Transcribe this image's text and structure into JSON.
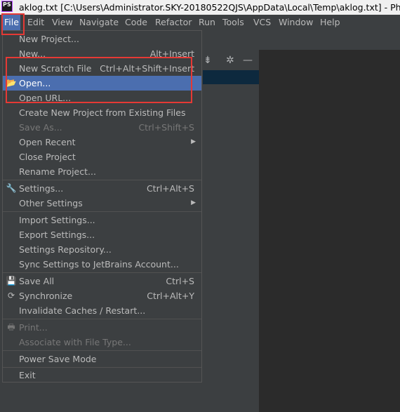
{
  "window": {
    "title": "aklog.txt [C:\\Users\\Administrator.SKY-20180522QJS\\AppData\\Local\\Temp\\aklog.txt] - PhpStorm",
    "app_icon_text": "PS"
  },
  "menubar": [
    "File",
    "Edit",
    "View",
    "Navigate",
    "Code",
    "Refactor",
    "Run",
    "Tools",
    "VCS",
    "Window",
    "Help"
  ],
  "file_menu": {
    "items": [
      {
        "label": "New Project...",
        "shortcut": ""
      },
      {
        "label": "New...",
        "shortcut": "Alt+Insert"
      },
      {
        "label": "New Scratch File",
        "shortcut": "Ctrl+Alt+Shift+Insert"
      },
      {
        "label": "Open...",
        "shortcut": ""
      },
      {
        "label": "Open URL...",
        "shortcut": ""
      },
      {
        "label": "Create New Project from Existing Files",
        "shortcut": ""
      },
      {
        "label": "Save As...",
        "shortcut": "Ctrl+Shift+S"
      },
      {
        "label": "Open Recent",
        "shortcut": ""
      },
      {
        "label": "Close Project",
        "shortcut": ""
      },
      {
        "label": "Rename Project...",
        "shortcut": ""
      },
      {
        "label": "Settings...",
        "shortcut": "Ctrl+Alt+S"
      },
      {
        "label": "Other Settings",
        "shortcut": ""
      },
      {
        "label": "Import Settings...",
        "shortcut": ""
      },
      {
        "label": "Export Settings...",
        "shortcut": ""
      },
      {
        "label": "Settings Repository...",
        "shortcut": ""
      },
      {
        "label": "Sync Settings to JetBrains Account...",
        "shortcut": ""
      },
      {
        "label": "Save All",
        "shortcut": "Ctrl+S"
      },
      {
        "label": "Synchronize",
        "shortcut": "Ctrl+Alt+Y"
      },
      {
        "label": "Invalidate Caches / Restart...",
        "shortcut": ""
      },
      {
        "label": "Print...",
        "shortcut": ""
      },
      {
        "label": "Associate with File Type...",
        "shortcut": ""
      },
      {
        "label": "Power Save Mode",
        "shortcut": ""
      },
      {
        "label": "Exit",
        "shortcut": ""
      }
    ]
  },
  "colors": {
    "highlight": "#4b6eaf",
    "annotation_red": "#e53935"
  }
}
